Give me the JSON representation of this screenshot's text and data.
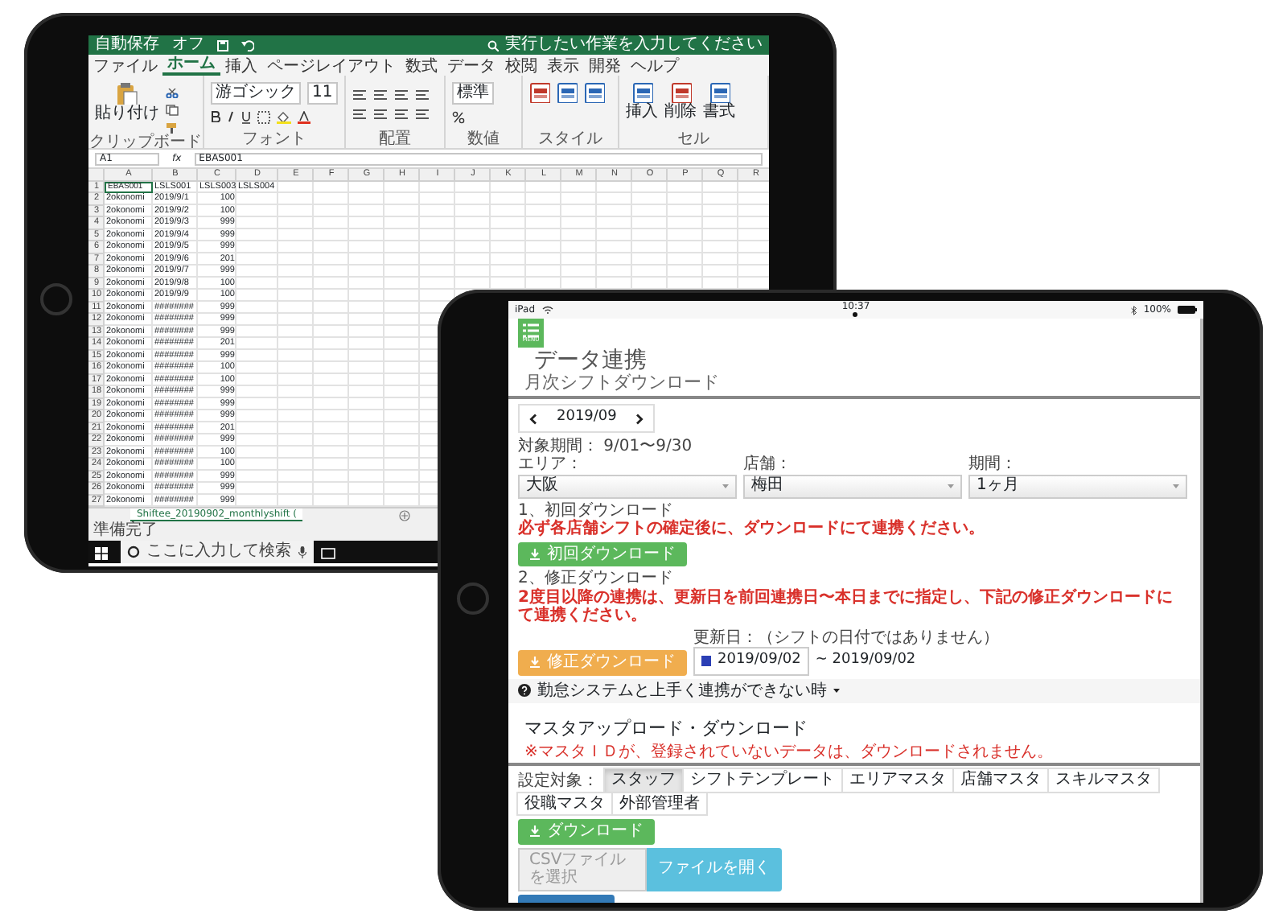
{
  "left_tablet": {
    "excel": {
      "title_bar": {
        "autosave": "自動保存",
        "autosave_state": "オフ",
        "search_placeholder": "実行したい作業を入力してください"
      },
      "ribbon_tabs": [
        {
          "label": "ファイル",
          "selected": false
        },
        {
          "label": "ホーム",
          "selected": true
        },
        {
          "label": "挿入",
          "selected": false
        },
        {
          "label": "ページレイアウト",
          "selected": false
        },
        {
          "label": "数式",
          "selected": false
        },
        {
          "label": "データ",
          "selected": false
        },
        {
          "label": "校閲",
          "selected": false
        },
        {
          "label": "表示",
          "selected": false
        },
        {
          "label": "開発",
          "selected": false
        },
        {
          "label": "ヘルプ",
          "selected": false
        }
      ],
      "ribbon_groups": [
        {
          "kind": "clipboard",
          "label": "クリップボード",
          "buttons": [
            "貼り付け"
          ]
        },
        {
          "kind": "font",
          "label": "フォント",
          "font_name": "游ゴシック",
          "font_size": "11"
        },
        {
          "kind": "alignment",
          "label": "配置"
        },
        {
          "kind": "number",
          "label": "数値",
          "format": "標準"
        },
        {
          "kind": "styles",
          "label": "スタイル"
        },
        {
          "kind": "cells",
          "label": "セル",
          "buttons": [
            "挿入",
            "削除",
            "書式"
          ]
        }
      ],
      "name_box": "A1",
      "fx": "fx",
      "formula": "EBAS001",
      "columns": [
        "A",
        "B",
        "C",
        "D",
        "E",
        "F",
        "G",
        "H",
        "I",
        "J",
        "K",
        "L",
        "M",
        "N",
        "O",
        "P",
        "Q",
        "R"
      ],
      "rows": [
        {
          "number": "1",
          "cells": [
            "EBAS001",
            "LSLS001",
            "LSLS003",
            "LSLS004"
          ]
        },
        {
          "number": "2",
          "cells": [
            "2okonomi",
            "2019/9/1",
            "100"
          ]
        },
        {
          "number": "3",
          "cells": [
            "2okonomi",
            "2019/9/2",
            "100"
          ]
        },
        {
          "number": "4",
          "cells": [
            "2okonomi",
            "2019/9/3",
            "999"
          ]
        },
        {
          "number": "5",
          "cells": [
            "2okonomi",
            "2019/9/4",
            "999"
          ]
        },
        {
          "number": "6",
          "cells": [
            "2okonomi",
            "2019/9/5",
            "999"
          ]
        },
        {
          "number": "7",
          "cells": [
            "2okonomi",
            "2019/9/6",
            "201"
          ]
        },
        {
          "number": "8",
          "cells": [
            "2okonomi",
            "2019/9/7",
            "999"
          ]
        },
        {
          "number": "9",
          "cells": [
            "2okonomi",
            "2019/9/8",
            "100"
          ]
        },
        {
          "number": "10",
          "cells": [
            "2okonomi",
            "2019/9/9",
            "100"
          ]
        },
        {
          "number": "11",
          "cells": [
            "2okonomi",
            "########",
            "999"
          ]
        },
        {
          "number": "12",
          "cells": [
            "2okonomi",
            "########",
            "999"
          ]
        },
        {
          "number": "13",
          "cells": [
            "2okonomi",
            "########",
            "999"
          ]
        },
        {
          "number": "14",
          "cells": [
            "2okonomi",
            "########",
            "201"
          ]
        },
        {
          "number": "15",
          "cells": [
            "2okonomi",
            "########",
            "999"
          ]
        },
        {
          "number": "16",
          "cells": [
            "2okonomi",
            "########",
            "100"
          ]
        },
        {
          "number": "17",
          "cells": [
            "2okonomi",
            "########",
            "100"
          ]
        },
        {
          "number": "18",
          "cells": [
            "2okonomi",
            "########",
            "999"
          ]
        },
        {
          "number": "19",
          "cells": [
            "2okonomi",
            "########",
            "999"
          ]
        },
        {
          "number": "20",
          "cells": [
            "2okonomi",
            "########",
            "999"
          ]
        },
        {
          "number": "21",
          "cells": [
            "2okonomi",
            "########",
            "201"
          ]
        },
        {
          "number": "22",
          "cells": [
            "2okonomi",
            "########",
            "999"
          ]
        },
        {
          "number": "23",
          "cells": [
            "2okonomi",
            "########",
            "100"
          ]
        },
        {
          "number": "24",
          "cells": [
            "2okonomi",
            "########",
            "100"
          ]
        },
        {
          "number": "25",
          "cells": [
            "2okonomi",
            "########",
            "999"
          ]
        },
        {
          "number": "26",
          "cells": [
            "2okonomi",
            "########",
            "999"
          ]
        },
        {
          "number": "27",
          "cells": [
            "2okonomi",
            "########",
            "999"
          ]
        }
      ],
      "sheet_tab": "Shiftee_20190902_monthlyshift (",
      "status": "準備完了",
      "taskbar": {
        "search_placeholder": "ここに入力して検索"
      }
    }
  },
  "right_tablet": {
    "status_bar": {
      "device": "iPad",
      "time": "10:37",
      "battery": "100%"
    },
    "menu_label": "MENU",
    "title": "データ連携",
    "subtitle": "月次シフトダウンロード",
    "month": "2019/09",
    "period": "対象期間： 9/01〜9/30",
    "filters": [
      {
        "label": "エリア：",
        "value": "大阪"
      },
      {
        "label": "店舗：",
        "value": "梅田"
      },
      {
        "label": "期間：",
        "value": "1ヶ月"
      }
    ],
    "sections": [
      {
        "heading": "1、初回ダウンロード",
        "note": "必ず各店舗シフトの確定後に、ダウンロードにて連携ください。",
        "button": "初回ダウンロード",
        "kind": "initial"
      },
      {
        "heading": "2、修正ダウンロード",
        "note": "2度目以降の連携は、更新日を前回連携日〜本日までに指定し、下記の修正ダウンロードにて連携ください。",
        "button": "修正ダウンロード",
        "kind": "revision",
        "date_label": "更新日：（シフトの日付ではありません）",
        "date_from": "2019/09/02",
        "date_to": "~ 2019/09/02"
      }
    ],
    "help": "勤怠システムと上手く連携ができない時",
    "master": {
      "heading": "マスタアップロード・ダウンロード",
      "note": "※マスタＩＤが、登録されていないデータは、ダウンロードされません。",
      "target_label": "設定対象：",
      "tabs": [
        {
          "label": "スタッフ",
          "selected": true
        },
        {
          "label": "シフトテンプレート",
          "selected": false
        },
        {
          "label": "エリアマスタ",
          "selected": false
        },
        {
          "label": "店舗マスタ",
          "selected": false
        },
        {
          "label": "スキルマスタ",
          "selected": false
        },
        {
          "label": "役職マスタ",
          "selected": false
        },
        {
          "label": "外部管理者",
          "selected": false
        }
      ],
      "download_button": "ダウンロード",
      "file_placeholder": "CSVファイルを選択",
      "open_button": "ファイルを開く"
    }
  }
}
